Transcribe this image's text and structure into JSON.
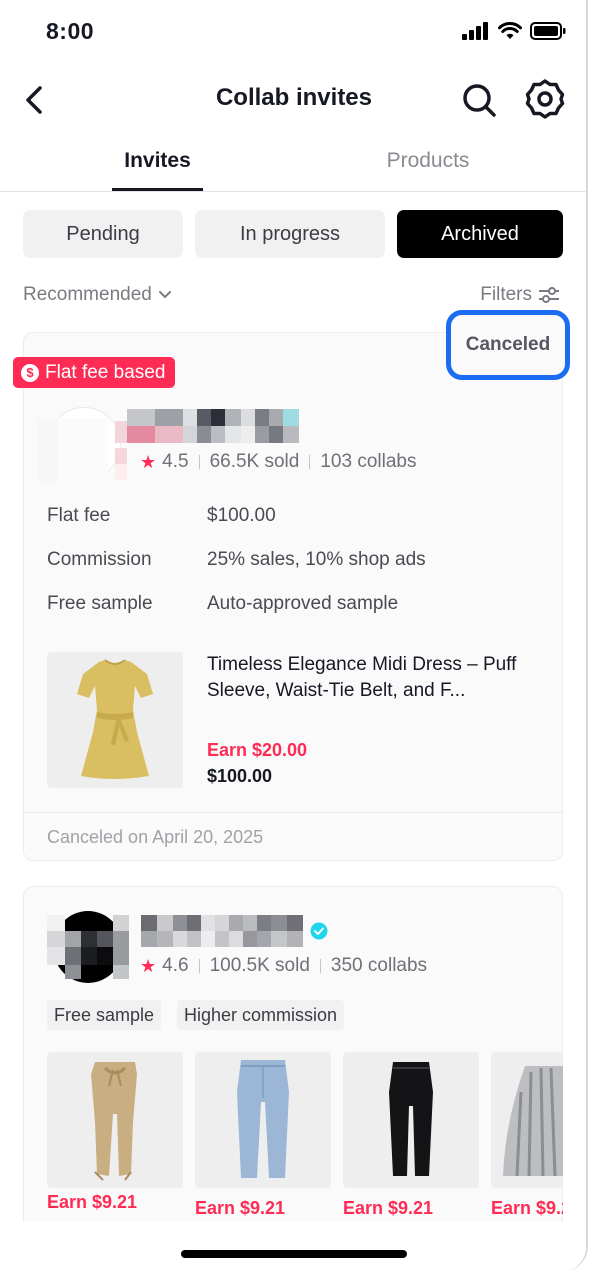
{
  "status_bar": {
    "time": "8:00"
  },
  "nav": {
    "title": "Collab invites"
  },
  "tabs": [
    {
      "label": "Invites",
      "active": true
    },
    {
      "label": "Products",
      "active": false
    }
  ],
  "segments": [
    {
      "label": "Pending",
      "active": false
    },
    {
      "label": "In progress",
      "active": false
    },
    {
      "label": "Archived",
      "active": true
    }
  ],
  "sort": {
    "label": "Recommended"
  },
  "filters": {
    "label": "Filters"
  },
  "colors": {
    "accent": "#fe2c55",
    "highlight": "#1a6cf2",
    "verified": "#20d5ec"
  },
  "cards": [
    {
      "badge": "Flat fee based",
      "status": "Canceled",
      "rating": "4.5",
      "sold": "66.5K sold",
      "collabs": "103 collabs",
      "terms": [
        {
          "label": "Flat fee",
          "value": "$100.00"
        },
        {
          "label": "Commission",
          "value": "25% sales, 10% shop ads"
        },
        {
          "label": "Free sample",
          "value": "Auto-approved sample"
        }
      ],
      "product": {
        "title": "Timeless Elegance Midi Dress – Puff Sleeve, Waist-Tie Belt, and F...",
        "earn": "Earn $20.00",
        "price": "$100.00"
      },
      "footer": "Canceled on April 20, 2025"
    },
    {
      "rating": "4.6",
      "sold": "100.5K sold",
      "collabs": "350 collabs",
      "tags": [
        "Free sample",
        "Higher commission"
      ],
      "products": [
        {
          "earn": "Earn $9.21"
        },
        {
          "earn": "Earn $9.21"
        },
        {
          "earn": "Earn $9.21"
        },
        {
          "earn": "Earn $9.2"
        }
      ]
    }
  ]
}
